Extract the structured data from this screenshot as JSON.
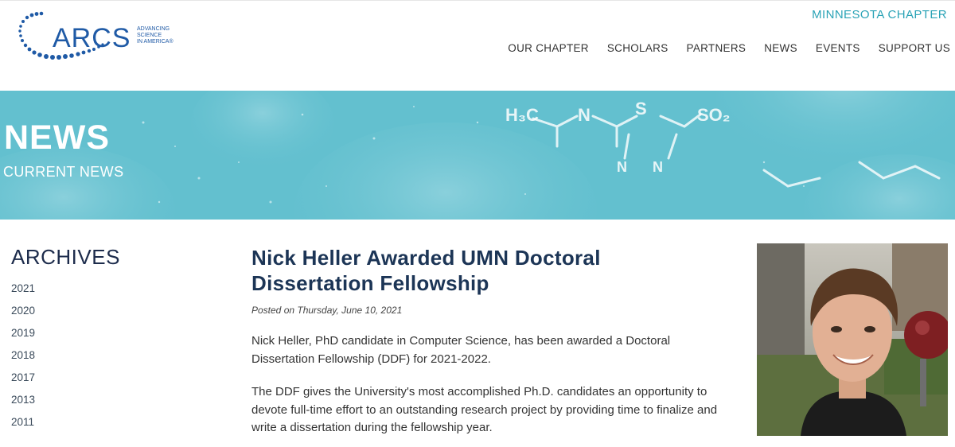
{
  "header": {
    "logo": {
      "wordmark": "ARCS",
      "tagline": [
        "ADVANCING",
        "SCIENCE",
        "IN AMERICA®"
      ],
      "icon": "dotted-arc-logo"
    },
    "chapter_label": "MINNESOTA CHAPTER",
    "nav": [
      {
        "label": "OUR CHAPTER"
      },
      {
        "label": "SCHOLARS"
      },
      {
        "label": "PARTNERS"
      },
      {
        "label": "NEWS"
      },
      {
        "label": "EVENTS"
      },
      {
        "label": "SUPPORT US"
      }
    ]
  },
  "banner": {
    "title": "NEWS",
    "subtitle": "CURRENT NEWS",
    "background": "molecule-pattern",
    "molecule_text": [
      "H₃C",
      "N",
      "S",
      "SO₂",
      "N",
      "N"
    ]
  },
  "sidebar": {
    "title": "ARCHIVES",
    "years": [
      "2021",
      "2020",
      "2019",
      "2018",
      "2017",
      "2013",
      "2011"
    ]
  },
  "article": {
    "title": "Nick Heller Awarded UMN Doctoral Dissertation Fellowship",
    "posted": "Posted on Thursday, June 10, 2021",
    "paragraphs": [
      "Nick Heller, PhD candidate in Computer Science, has been awarded a Doctoral Dissertation Fellowship (DDF) for 2021-2022.",
      "The DDF gives the University's most accomplished Ph.D. candidates an opportunity to devote full-time effort to an outstanding research project by providing time to finalize and write a dissertation during the fellowship year."
    ]
  },
  "colors": {
    "accent": "#2aa3b6",
    "banner": "#63c0cf",
    "heading": "#1c3556",
    "logo_blue": "#1f5aa6"
  }
}
